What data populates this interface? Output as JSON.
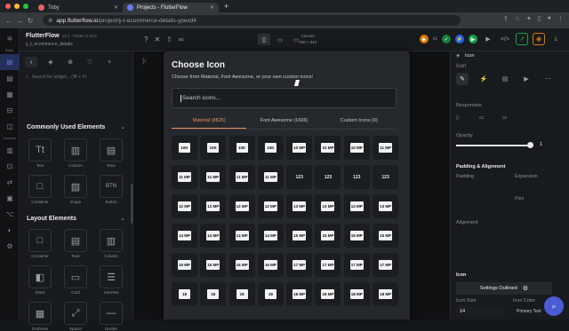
{
  "browser": {
    "tabs": [
      {
        "label": "Toby",
        "fav_color": "#e06666"
      },
      {
        "label": "Projects - FlutterFlow",
        "fav_color": "#6b7cff"
      }
    ],
    "url_host": "app.flutterflow.io",
    "url_path": "/project/y-t-ecommerce-details-ypexd4"
  },
  "project": {
    "name": "FlutterFlow",
    "version": "v3.1 · Flutter 3.10.6",
    "subtitle": "y_t_ecommerce_details"
  },
  "device": {
    "zoom_title": "Canvas",
    "zoom_size": "390 × 844"
  },
  "left_panel": {
    "search_placeholder": "Search for widget...  (⌘ + F)",
    "section1": "Commonly Used Elements",
    "common": [
      {
        "label": "Text",
        "icon": "Tt"
      },
      {
        "label": "Column",
        "icon": "▥"
      },
      {
        "label": "Row",
        "icon": "▤"
      },
      {
        "label": "Container",
        "icon": "□"
      },
      {
        "label": "Image",
        "icon": "▨"
      },
      {
        "label": "Button",
        "icon": "BTN"
      }
    ],
    "section2": "Layout Elements",
    "layout": [
      {
        "label": "Container",
        "icon": "□"
      },
      {
        "label": "Row",
        "icon": "▤"
      },
      {
        "label": "Column",
        "icon": "▥"
      },
      {
        "label": "Stack",
        "icon": "◧"
      },
      {
        "label": "Card",
        "icon": "▭"
      },
      {
        "label": "ListView",
        "icon": "☰"
      },
      {
        "label": "GridView",
        "icon": "▦"
      },
      {
        "label": "Spacer",
        "icon": "⤢"
      },
      {
        "label": "Divider",
        "icon": "—"
      }
    ]
  },
  "modal": {
    "title": "Choose Icon",
    "subtitle": "Choose from Material, Font Awesome, or your own custom icons!",
    "search_placeholder": "Search icons...",
    "tabs": [
      "Material (8825)",
      "Font Awesome (1606)",
      "Custom Icons (0)"
    ],
    "icons": [
      "10K",
      "10K",
      "10K",
      "10K",
      "10 MP",
      "10 MP",
      "10 MP",
      "11 MP",
      "11 MP",
      "11 MP",
      "11 MP",
      "11 MP",
      "123",
      "123",
      "123",
      "123",
      "12 MP",
      "12 MP",
      "12 MP",
      "12 MP",
      "13 MP",
      "13 MP",
      "13 MP",
      "13 MP",
      "14 MP",
      "14 MP",
      "14 MP",
      "14 MP",
      "15 MP",
      "15 MP",
      "15 MP",
      "15 MP",
      "16 MP",
      "16 MP",
      "16 MP",
      "16 MP",
      "17 MP",
      "17 MP",
      "17 MP",
      "17 MP",
      "18",
      "18",
      "18",
      "18",
      "18 MP",
      "18 MP",
      "18 MP",
      "18 MP"
    ]
  },
  "right_panel": {
    "widget": "Icon",
    "widget_sub": "Icon",
    "responsive": "Responsive",
    "opacity": "Opacity",
    "opacity_value": "1",
    "padding_title": "Padding & Alignment",
    "padding": "Padding",
    "expansion": "Expansion",
    "flex": "Flex",
    "alignment": "Alignment",
    "icon_section": "Icon",
    "settings_btn": "Settings Outlined",
    "icon_size_label": "Icon Size",
    "icon_size": "14",
    "icon_color_label": "Icon Color",
    "icon_color": "Primary Text"
  }
}
